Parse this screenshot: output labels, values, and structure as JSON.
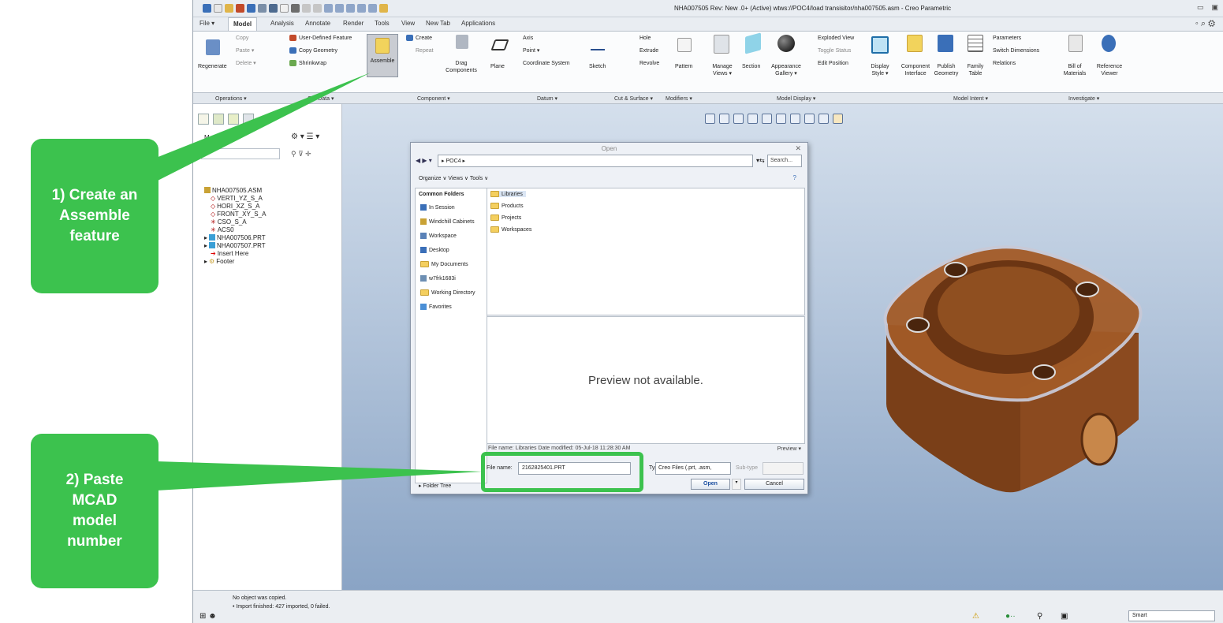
{
  "app": {
    "title": "NHA007505 Rev: New .0+  (Active) wtws://POC4/load transisitor/nha007505.asm - Creo Parametric",
    "menu_tabs": [
      "File ▾",
      "Model",
      "Analysis",
      "Annotate",
      "Render",
      "Tools",
      "View",
      "New Tab",
      "Applications"
    ],
    "active_tab": "Model"
  },
  "ribbon": {
    "regenerate": "Regenerate",
    "copy": "Copy",
    "paste": "Paste ▾",
    "delete": "Delete ▾",
    "udf": "User-Defined Feature",
    "copy_geometry": "Copy Geometry",
    "shrinkwrap": "Shrinkwrap",
    "assemble": "Assemble",
    "create": "Create",
    "repeat": "Repeat",
    "drag_components": "Drag Components",
    "plane": "Plane",
    "axis": "Axis",
    "point": "Point ▾",
    "coordinate_system": "Coordinate System",
    "sketch": "Sketch",
    "hole": "Hole",
    "extrude": "Extrude",
    "revolve": "Revolve",
    "pattern": "Pattern",
    "manage_views": "Manage Views ▾",
    "section": "Section",
    "appearance_gallery": "Appearance Gallery ▾",
    "exploded_view": "Exploded View",
    "toggle_status": "Toggle Status",
    "edit_position": "Edit Position",
    "display_style": "Display Style ▾",
    "component_interface": "Component Interface",
    "publish_geometry": "Publish Geometry",
    "family_table": "Family Table",
    "parameters": "Parameters",
    "switch_dimensions": "Switch Dimensions",
    "relations": "Relations",
    "bill_of_materials": "Bill of Materials",
    "reference_viewer": "Reference Viewer"
  },
  "groups": [
    "Operations ▾",
    "Get Data ▾",
    "Component ▾",
    "Datum ▾",
    "Cut & Surface ▾",
    "Modifiers ▾",
    "Model Display ▾",
    "Model Intent ▾",
    "Investigate ▾"
  ],
  "tree": {
    "header": "M",
    "items": [
      "NHA007505.ASM",
      "VERTI_YZ_S_A",
      "HORI_XZ_S_A",
      "FRONT_XY_S_A",
      "CSO_S_A",
      "ACS0",
      "NHA007506.PRT",
      "NHA007507.PRT",
      "Insert Here",
      "Footer"
    ]
  },
  "dialog": {
    "title": "Open",
    "breadcrumb": "▸ POC4 ▸",
    "search_placeholder": "Search...",
    "toolbar": "Organize ∨   Views ∨   Tools ∨",
    "common_header": "Common Folders",
    "common_items": [
      "In Session",
      "Windchill Cabinets",
      "Workspace",
      "Desktop",
      "My Documents",
      "w7frk1683i",
      "Working Directory",
      "Favorites"
    ],
    "files": [
      "Libraries",
      "Products",
      "Projects",
      "Workspaces"
    ],
    "preview_text": "Preview not available.",
    "file_info": "File name: Libraries  Date modified: 05-Jul-18 11:28:30 AM",
    "preview_menu": "Preview ▾",
    "file_name_label": "File name:",
    "file_name_value": "2162825401.PRT",
    "type_label": "Type",
    "type_value": "Creo Files (.prt, .asm,",
    "subtype_label": "Sub-type",
    "folder_tree": "▸ Folder Tree",
    "open_label": "Open",
    "cancel_label": "Cancel"
  },
  "status": {
    "line1": "No object was copied.",
    "line2": "• Import finished: 427 imported, 0 failed.",
    "smart": "Smart"
  },
  "callouts": {
    "c1": "1) Create an\nAssemble\nfeature",
    "c2": "2) Paste\nMCAD\nmodel\nnumber"
  },
  "colors": {
    "callout_green": "#3cc24e",
    "part_brown": "#8b4a1f"
  }
}
